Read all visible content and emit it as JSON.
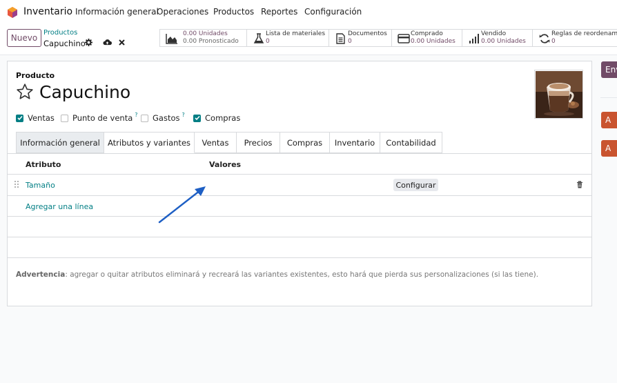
{
  "topnav": {
    "app_name": "Inventario",
    "menu": [
      "Información general",
      "Operaciones",
      "Productos",
      "Reportes",
      "Configuración"
    ]
  },
  "control_panel": {
    "new_label": "Nuevo",
    "breadcrumb_parent": "Productos",
    "breadcrumb_current": "Capuchino",
    "stats": [
      {
        "icon": "area-chart-icon",
        "line1": "0.00 Unidades",
        "line2": "0.00 Pronosticado"
      },
      {
        "icon": "flask-icon",
        "line1": "Lista de materiales",
        "line2": "0"
      },
      {
        "icon": "document-icon",
        "line1": "Documentos",
        "line2": "0"
      },
      {
        "icon": "credit-card-icon",
        "line1": "Comprado",
        "line2": "0.00 Unidades"
      },
      {
        "icon": "bar-chart-icon",
        "line1": "Vendido",
        "line2": "0.00 Unidades"
      },
      {
        "icon": "refresh-icon",
        "line1": "Reglas de reordenam",
        "line2": "0"
      }
    ]
  },
  "form": {
    "label": "Producto",
    "name": "Capuchino",
    "checkboxes": [
      {
        "label": "Ventas",
        "checked": true,
        "help": false
      },
      {
        "label": "Punto de venta",
        "checked": false,
        "help": true
      },
      {
        "label": "Gastos",
        "checked": false,
        "help": true
      },
      {
        "label": "Compras",
        "checked": true,
        "help": false
      }
    ],
    "help_mark": "?",
    "tabs": [
      "Información general",
      "Atributos y variantes",
      "Ventas",
      "Precios",
      "Compras",
      "Inventario",
      "Contabilidad"
    ],
    "active_tab": "Atributos y variantes",
    "table": {
      "headers": [
        "Atributo",
        "Valores"
      ],
      "rows": [
        {
          "attribute": "Tamaño",
          "values": "",
          "configure": "Configurar"
        }
      ],
      "add_line": "Agregar una línea"
    },
    "warning_bold": "Advertencia",
    "warning_text": ": agregar o quitar atributos eliminará y recreará las variantes existentes, esto hará que pierda sus personalizaciones (si las tiene)."
  },
  "right_side": {
    "top_button": "Enviar",
    "avatars": [
      "A",
      "A"
    ]
  },
  "colors": {
    "brand": "#714b67",
    "link": "#017e84",
    "arrow": "#1e5fc4",
    "avatar": "#c9542f"
  }
}
